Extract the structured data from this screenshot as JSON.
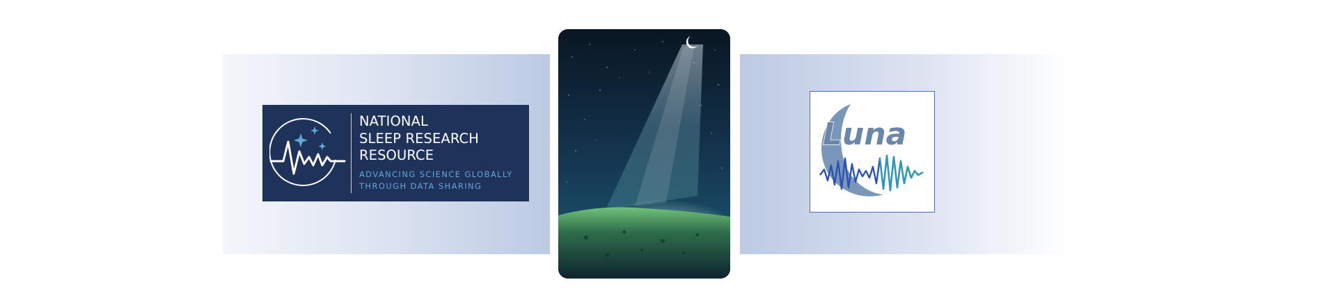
{
  "nsrr": {
    "title_lines": [
      "NATIONAL",
      "SLEEP RESEARCH",
      "RESOURCE"
    ],
    "tagline_lines": [
      "ADVANCING SCIENCE GLOBALLY",
      "THROUGH DATA SHARING"
    ]
  },
  "luna": {
    "logo_text": "Luna"
  },
  "colors": {
    "nsrr_background": "#1f3259",
    "nsrr_tagline": "#5fa8d8",
    "luna_moon": "#7a96b8",
    "luna_border": "#4a6ac2",
    "band_accent": "#bccae4"
  }
}
